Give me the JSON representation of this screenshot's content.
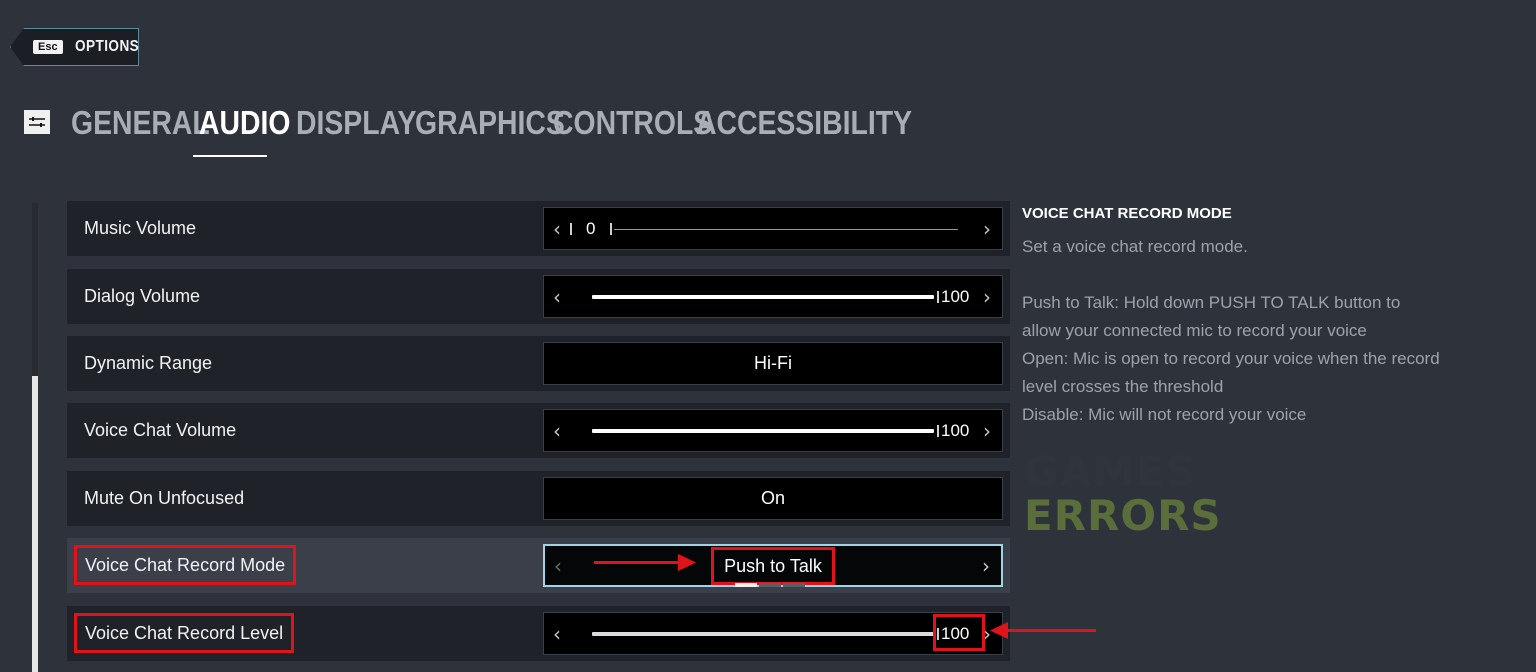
{
  "header": {
    "esc_key": "Esc",
    "back_label": "OPTIONS"
  },
  "tabs": [
    {
      "label": "GENERAL",
      "active": false
    },
    {
      "label": "AUDIO",
      "active": true
    },
    {
      "label": "DISPLAY",
      "active": false
    },
    {
      "label": "GRAPHICS",
      "active": false
    },
    {
      "label": "CONTROLS",
      "active": false
    },
    {
      "label": "ACCESSIBILITY",
      "active": false
    }
  ],
  "settings": {
    "music_volume": {
      "label": "Music Volume",
      "value": "0"
    },
    "dialog_volume": {
      "label": "Dialog Volume",
      "value": "100"
    },
    "dynamic_range": {
      "label": "Dynamic Range",
      "value": "Hi-Fi"
    },
    "voice_chat_volume": {
      "label": "Voice Chat Volume",
      "value": "100"
    },
    "mute_on_unfocused": {
      "label": "Mute On Unfocused",
      "value": "On"
    },
    "voice_chat_record_mode": {
      "label": "Voice Chat Record Mode",
      "value": "Push to Talk"
    },
    "voice_chat_record_level": {
      "label": "Voice Chat Record Level",
      "value": "100"
    }
  },
  "info_panel": {
    "title": "VOICE CHAT RECORD MODE",
    "subtitle": "Set a voice chat record mode.",
    "line1": "Push to Talk: Hold down PUSH TO TALK button to",
    "line2": "allow your connected mic to record your voice",
    "line3": "Open: Mic is open to record your voice when the record",
    "line4": "level crosses the threshold",
    "line5": "Disable: Mic will not record your voice"
  },
  "watermark": {
    "line1": "GAMES",
    "line2": "ERRORS"
  },
  "colors": {
    "background": "#2e323b",
    "row_bg": "#1f2229",
    "row_selected_bg": "#3b3f49",
    "annotation_red": "#e0121a",
    "active_border": "#9ed4e6"
  }
}
